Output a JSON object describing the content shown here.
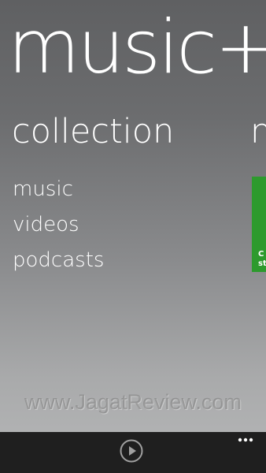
{
  "app": {
    "title": "music+"
  },
  "pivot": {
    "current_heading": "collection",
    "next_heading": "n"
  },
  "collection_menu": {
    "items": [
      {
        "label": "music"
      },
      {
        "label": "videos"
      },
      {
        "label": "podcasts"
      }
    ]
  },
  "next_panel": {
    "tile_color": "#2d9a2d",
    "tile_text_line1": "C",
    "tile_text_line2": "st"
  },
  "watermark": {
    "text": "www.JagatReview.com"
  },
  "app_bar": {
    "play_icon": "play-icon",
    "more_icon": "ellipsis-icon"
  }
}
